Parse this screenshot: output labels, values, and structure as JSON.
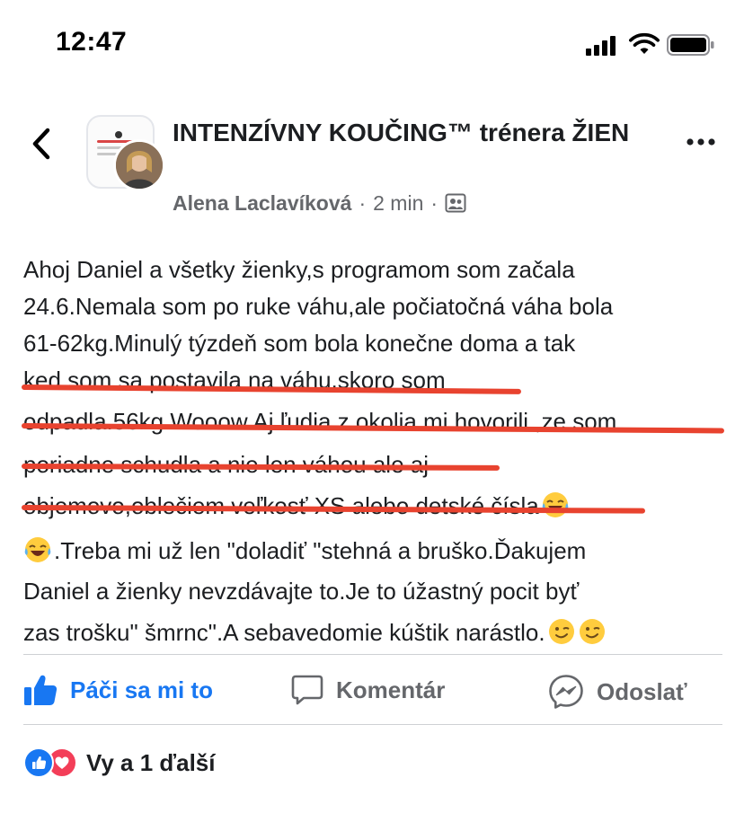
{
  "status_bar": {
    "time": "12:47"
  },
  "post": {
    "group_name": "INTENZÍVNY KOUČING™ trénera ŽIEN",
    "author": "Alena Laclavíková",
    "separator": "·",
    "time_ago": "2 min",
    "privacy_icon": "members-icon",
    "lines": [
      "Ahoj Daniel a všetky žienky,s programom som začala",
      "24.6.Nemala som po ruke váhu,ale počiatočná váha bola",
      "61-62kg.Minulý týzdeň som bola konečne doma a tak",
      "ked som sa postavila na váhu,skoro som",
      "odpadla.56kg.Wooow.Aj ľudia z okolia mi hovorili ,ze som",
      "poriadne schudla a nie len váhou ale aj",
      "objemovo,oblečiem veľkosť XS alebo detské čísla",
      ".Treba mi už len \"doladiť \"stehná a bruško.Ďakujem",
      "Daniel a žienky nevzdávajte to.Je to úžastný pocit byť",
      "zas trošku\" šmrnc\".A sebavedomie kúštik narástlo."
    ],
    "highlight_color": "#e8432f"
  },
  "actions": {
    "like_label": "Páči sa mi to",
    "comment_label": "Komentár",
    "share_label": "Odoslať"
  },
  "reactions": {
    "summary": "Vy a 1 ďalší"
  },
  "colors": {
    "like_blue": "#1877f2",
    "love_red": "#f33e58",
    "muted": "#65676b"
  }
}
